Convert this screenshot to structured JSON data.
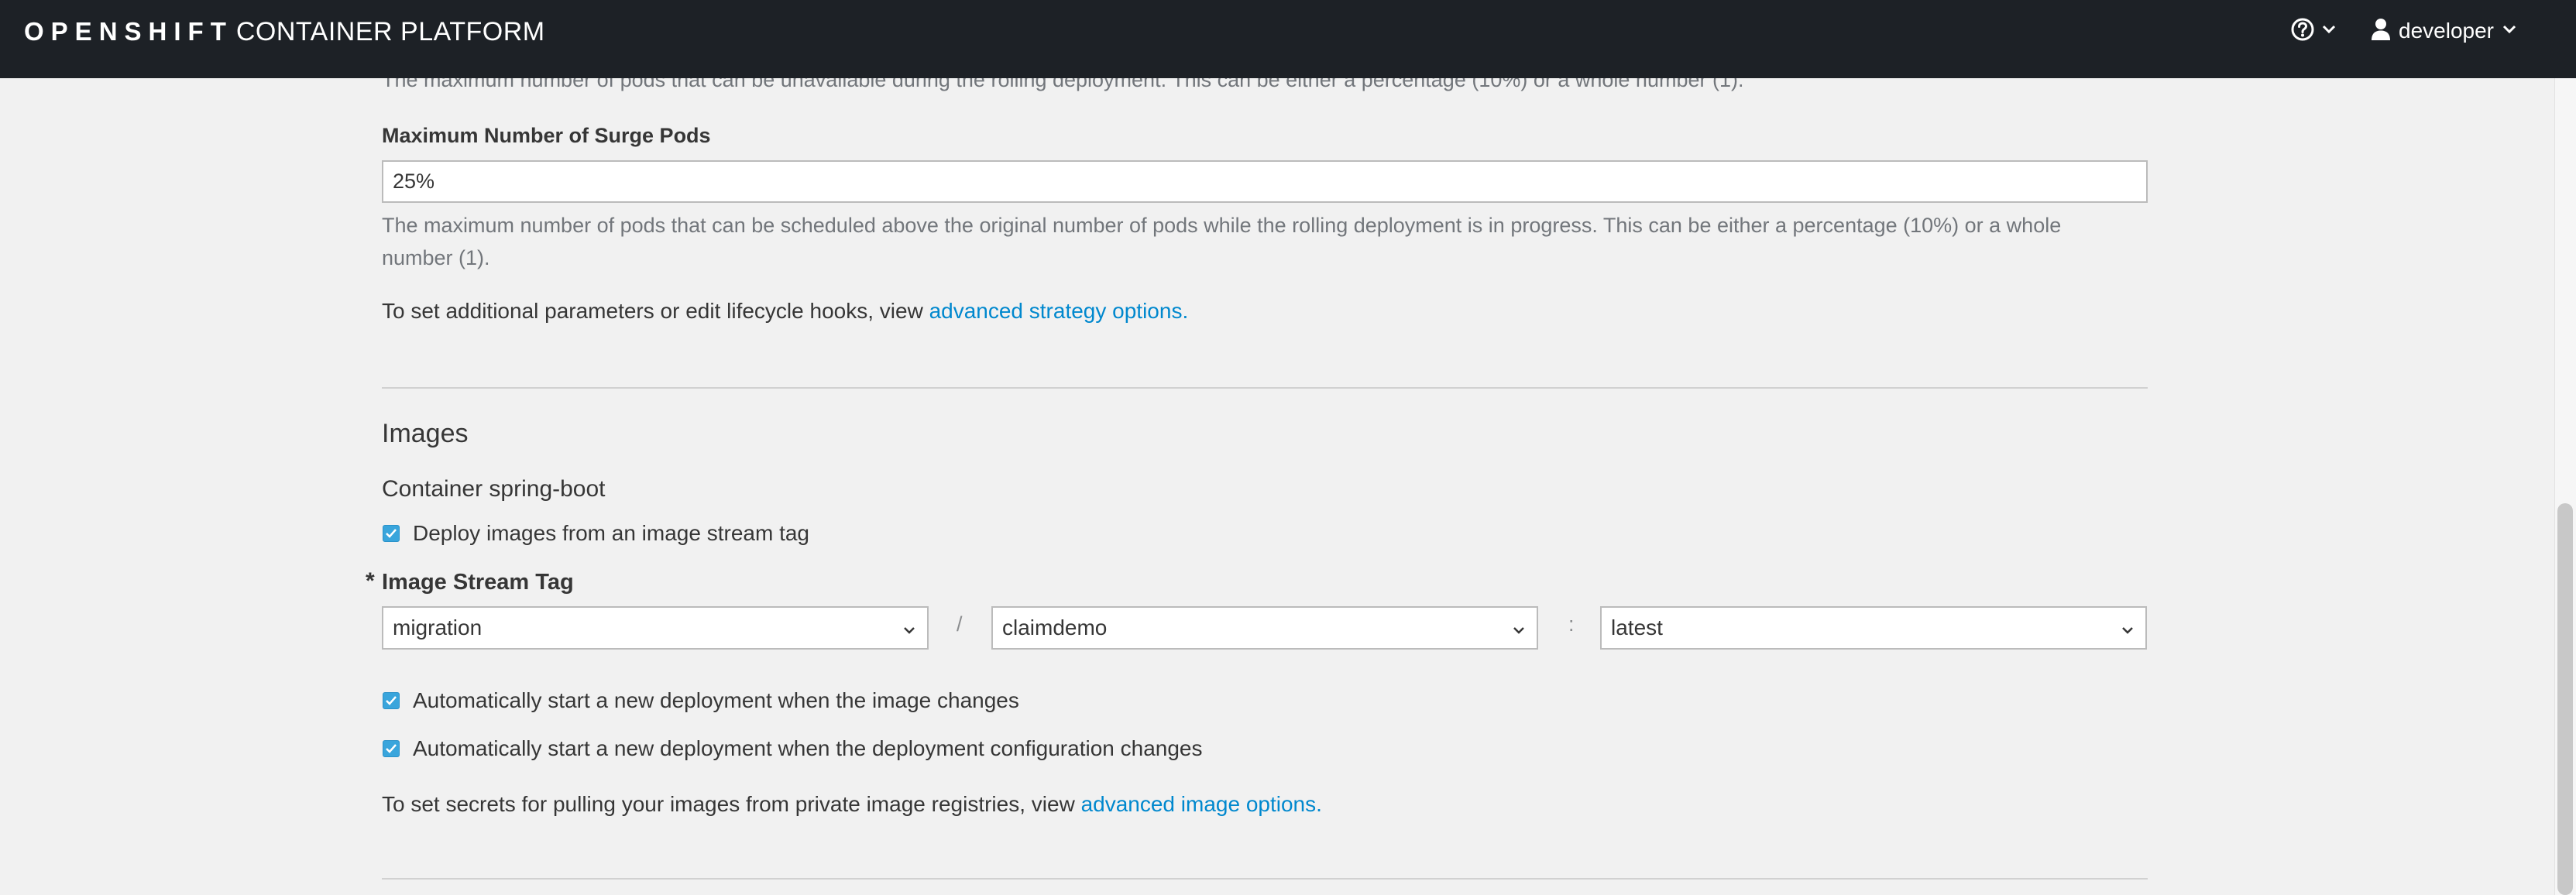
{
  "masthead": {
    "brand_bold": "OPENSHIFT",
    "brand_light": "CONTAINER PLATFORM",
    "help_icon": "question-circle-icon",
    "user_icon": "user-icon",
    "user_name": "developer"
  },
  "strategy": {
    "max_unavailable_help": "The maximum number of pods that can be unavailable during the rolling deployment. This can be either a percentage (10%) or a whole number (1).",
    "max_surge_label": "Maximum Number of Surge Pods",
    "max_surge_value": "25%",
    "max_surge_help_line1": "The maximum number of pods that can be scheduled above the original number of pods while the rolling deployment is in progress. This can be either a percentage (10%) or a whole",
    "max_surge_help_line2": "number (1).",
    "advanced_text": "To set additional parameters or edit lifecycle hooks, view ",
    "advanced_link": "advanced strategy options."
  },
  "images": {
    "heading": "Images",
    "container_title": "Container spring-boot",
    "deploy_from_tag_label": "Deploy images from an image stream tag",
    "deploy_from_tag_checked": true,
    "required_marker": "*",
    "image_stream_tag_label": "Image Stream Tag",
    "project_value": "migration",
    "slash": "/",
    "image_stream_value": "claimdemo",
    "colon": ":",
    "tag_value": "latest",
    "auto_image_change_label": "Automatically start a new deployment when the image changes",
    "auto_image_change_checked": true,
    "auto_config_change_label": "Automatically start a new deployment when the deployment configuration changes",
    "auto_config_change_checked": true,
    "secrets_text": "To set secrets for pulling your images from private image registries, view ",
    "secrets_link": "advanced image options."
  },
  "colors": {
    "masthead_bg": "#1d2126",
    "page_bg": "#f1f1f1",
    "link": "#0088ce",
    "checkbox": "#39a5dc"
  }
}
